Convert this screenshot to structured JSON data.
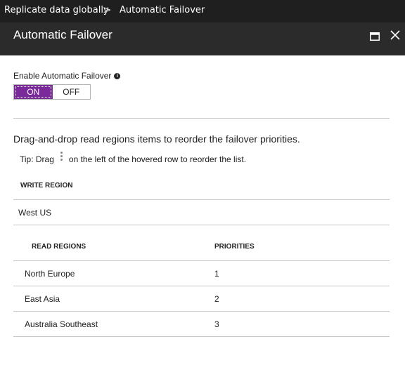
{
  "breadcrumb": {
    "parent": "Replicate data globally",
    "separator": ">",
    "current": "Automatic Failover"
  },
  "header": {
    "title": "Automatic Failover",
    "maximize_icon": "maximize-icon",
    "close_icon": "close-icon"
  },
  "failover": {
    "label": "Enable Automatic Failover",
    "info_icon": "info-icon",
    "on_label": "ON",
    "off_label": "OFF",
    "selected": "ON"
  },
  "instruction": "Drag-and-drop read regions items to reorder the failover priorities.",
  "tip": {
    "prefix": "Tip: Drag",
    "suffix": "on the left of the hovered row to reorder the list.",
    "icon": "drag-handle-icon"
  },
  "write_region": {
    "header": "WRITE REGION",
    "value": "West US"
  },
  "read_regions": {
    "header_region": "READ REGIONS",
    "header_priority": "PRIORITIES",
    "rows": [
      {
        "region": "North Europe",
        "priority": "1"
      },
      {
        "region": "East Asia",
        "priority": "2"
      },
      {
        "region": "Australia Southeast",
        "priority": "3"
      }
    ]
  },
  "colors": {
    "toggle_on": "#7a2a9a",
    "header_bg": "#2b2b2b",
    "breadcrumb_bg": "#1f1f1f"
  }
}
